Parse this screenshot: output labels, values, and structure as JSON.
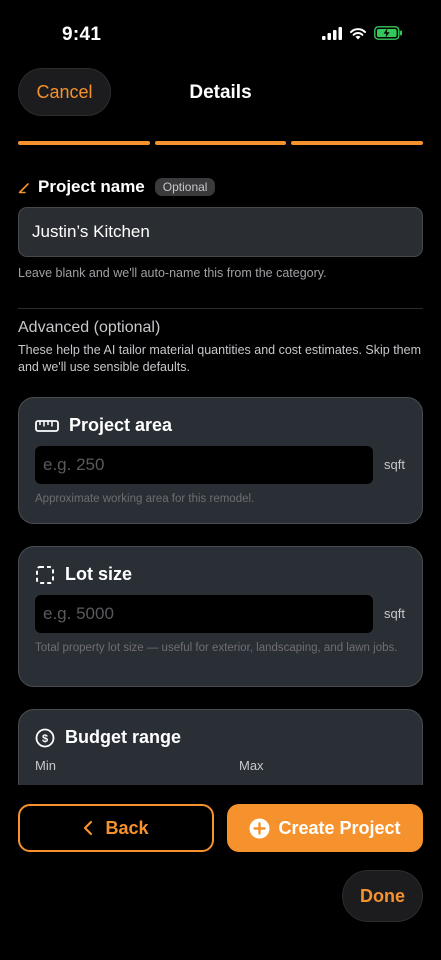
{
  "status_bar": {
    "time": "9:41",
    "icons": [
      "cellular-signal-icon",
      "wifi-icon",
      "battery-charging-icon"
    ]
  },
  "nav": {
    "cancel_label": "Cancel",
    "title": "Details"
  },
  "progress": {
    "steps_total": 3,
    "steps_completed": 3
  },
  "project_name": {
    "icon": "pencil-icon",
    "label": "Project name",
    "badge": "Optional",
    "value": "Justin’s Kitchen",
    "hint": "Leave blank and we'll auto-name this from the category."
  },
  "advanced": {
    "title": "Advanced (optional)",
    "description": "These help the AI tailor material quantities and cost estimates. Skip them and we'll use sensible defaults."
  },
  "cards": {
    "project_area": {
      "icon": "ruler-icon",
      "label": "Project area",
      "placeholder": "e.g. 250",
      "unit": "sqft",
      "hint": "Approximate working area for this remodel."
    },
    "lot_size": {
      "icon": "dashed-square-icon",
      "label": "Lot size",
      "placeholder": "e.g. 5000",
      "unit": "sqft",
      "hint": "Total property lot size — useful for exterior, landscaping, and lawn jobs."
    },
    "budget_range": {
      "icon": "dollar-circle-icon",
      "label": "Budget range",
      "min_label": "Min",
      "max_label": "Max"
    }
  },
  "actions": {
    "back_label": "Back",
    "create_label": "Create Project",
    "done_label": "Done"
  },
  "colors": {
    "accent": "#f6922d",
    "card_bg": "#2a2f35",
    "card_border": "#4a4c51",
    "battery": "#34c759"
  }
}
